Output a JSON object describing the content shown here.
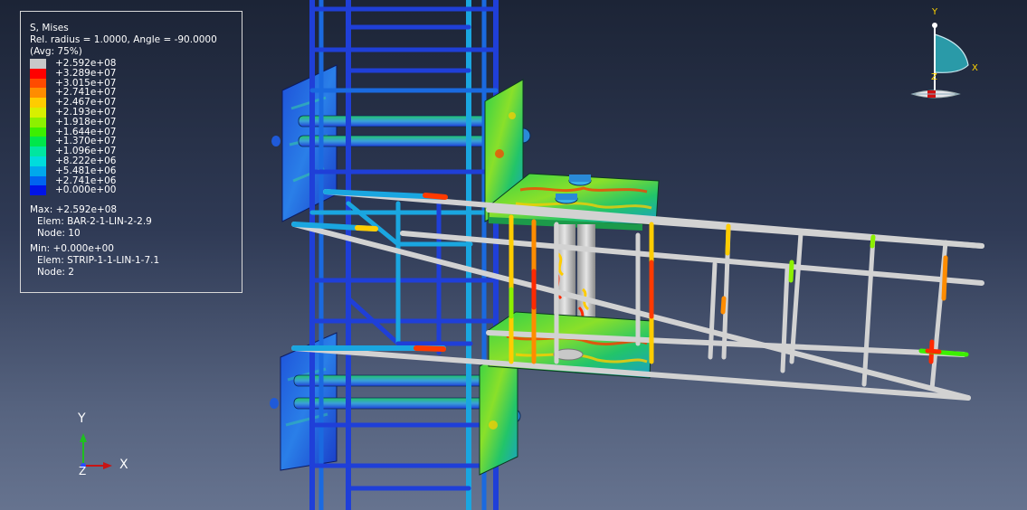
{
  "legend": {
    "title": "S, Mises",
    "subtitle": "Rel. radius = 1.0000, Angle = -90.0000",
    "averaging": "(Avg: 75%)",
    "scale": [
      {
        "label": "+2.592e+08",
        "color": "#c8c8c8"
      },
      {
        "label": "+3.289e+07",
        "color": "#ff0000"
      },
      {
        "label": "+3.015e+07",
        "color": "#ff4a00"
      },
      {
        "label": "+2.741e+07",
        "color": "#ff8c00"
      },
      {
        "label": "+2.467e+07",
        "color": "#ffcc00"
      },
      {
        "label": "+2.193e+07",
        "color": "#d8ef00"
      },
      {
        "label": "+1.918e+07",
        "color": "#8cf000"
      },
      {
        "label": "+1.644e+07",
        "color": "#3cef00"
      },
      {
        "label": "+1.370e+07",
        "color": "#00e74a"
      },
      {
        "label": "+1.096e+07",
        "color": "#00e6a0"
      },
      {
        "label": "+8.222e+06",
        "color": "#00dcdc"
      },
      {
        "label": "+5.481e+06",
        "color": "#00a8ec"
      },
      {
        "label": "+2.741e+06",
        "color": "#0064f0"
      },
      {
        "label": "+0.000e+00",
        "color": "#0014e6"
      }
    ],
    "max_line": "Max: +2.592e+08",
    "max_elem": "Elem: BAR-2-1-LIN-2-2.9",
    "max_node": "Node: 10",
    "min_line": "Min: +0.000e+00",
    "min_elem": "Elem: STRIP-1-1-LIN-1-7.1",
    "min_node": "Node: 2"
  },
  "triad": {
    "y_label": "Y",
    "x_label": "X",
    "z_label": "Z",
    "y_color": "#1fbf1f",
    "x_color": "#c81414",
    "z_color": "#2a4cff"
  },
  "view_cube": {
    "y_label": "Y",
    "x_label": "X",
    "z_label": "Z",
    "label_color": "#ffd400"
  },
  "colors": {
    "background_top": "#1c2436",
    "background_bottom": "#66738f",
    "rebar_low": "#1f3fd8",
    "rebar_mid": "#1aa6e0",
    "beam_bar": "#d2d2d2"
  }
}
